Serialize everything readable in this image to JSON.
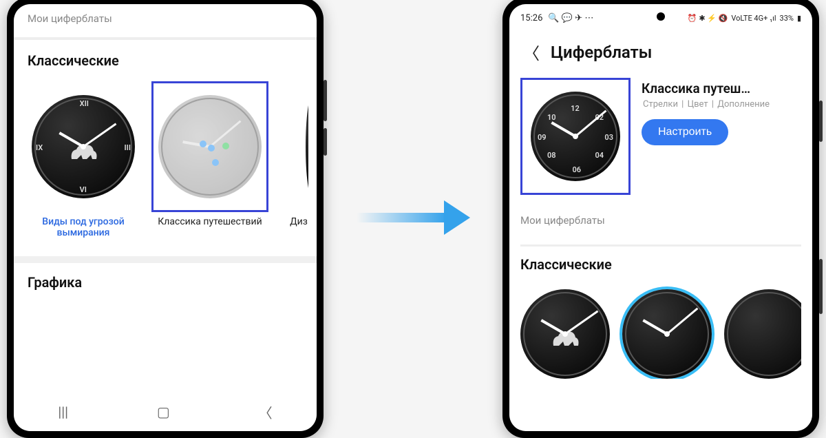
{
  "left_phone": {
    "my_watch_faces": "Мои циферблаты",
    "section_classic": "Классические",
    "section_graphic": "Графика",
    "faces": [
      {
        "label": "Виды под угрозой вымирания",
        "selected": true
      },
      {
        "label": "Классика путешествий",
        "highlighted": true
      },
      {
        "label": "Диз"
      }
    ]
  },
  "right_phone": {
    "status": {
      "time": "15:26",
      "icons_left": "🔍 💬 ✈ ⋯",
      "icons_right": "⏰ ✱ ⚡ 🔇",
      "network": "VoLTE 4G+ ₁ıl",
      "battery_pct": "33%"
    },
    "header_title": "Циферблаты",
    "detail": {
      "title": "Классика путеш…",
      "meta1": "Стрелки",
      "meta2": "Цвет",
      "meta3": "Дополнение",
      "configure": "Настроить"
    },
    "my_watch_faces": "Мои циферблаты",
    "section_classic": "Классические"
  }
}
